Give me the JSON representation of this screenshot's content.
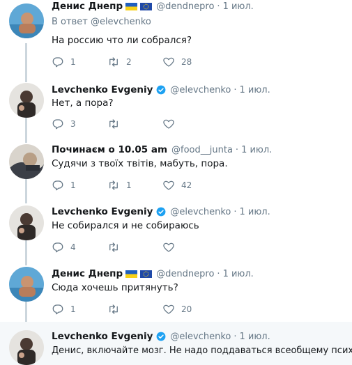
{
  "tweets": [
    {
      "name": "Денис Днепр",
      "handle": "@dendnepro",
      "time": "1 июл.",
      "reply_to": "В ответ @elevchenko",
      "text": "На россию что ли собрался?",
      "replies": "1",
      "retweets": "2",
      "likes": "28",
      "flags": [
        "ukraine-flag-icon",
        "eu-flag-icon"
      ]
    },
    {
      "name": "Levchenko Evgeniy",
      "handle": "@elevchenko",
      "time": "1 июл.",
      "verified": true,
      "text": "Нет, а пора?",
      "replies": "3",
      "retweets": "",
      "likes": ""
    },
    {
      "name": "Починаєм о 10.05 am",
      "handle": "@food__junta",
      "time": "1 июл.",
      "text": "Судячи з твоїх твітів, мабуть, пора.",
      "replies": "1",
      "retweets": "1",
      "likes": "42"
    },
    {
      "name": "Levchenko Evgeniy",
      "handle": "@elevchenko",
      "time": "1 июл.",
      "verified": true,
      "text": "Не собирался и не собираюсь",
      "replies": "4",
      "retweets": "",
      "likes": ""
    },
    {
      "name": "Денис Днепр",
      "handle": "@dendnepro",
      "time": "1 июл.",
      "text": "Сюда хочешь притянуть?",
      "replies": "1",
      "retweets": "",
      "likes": "20",
      "flags": [
        "ukraine-flag-icon",
        "eu-flag-icon"
      ]
    },
    {
      "name": "Levchenko Evgeniy",
      "handle": "@elevchenko",
      "time": "1 июл.",
      "verified": true,
      "text": "Денис, включайте мозг. Не надо поддаваться всеобщему психозу",
      "highlighted": true
    }
  ],
  "dot": "·",
  "colors": {
    "accent": "#1da1f2",
    "muted": "#657786",
    "thread_line": "#ccd6dd",
    "highlight_bg": "#f5f8fa"
  }
}
